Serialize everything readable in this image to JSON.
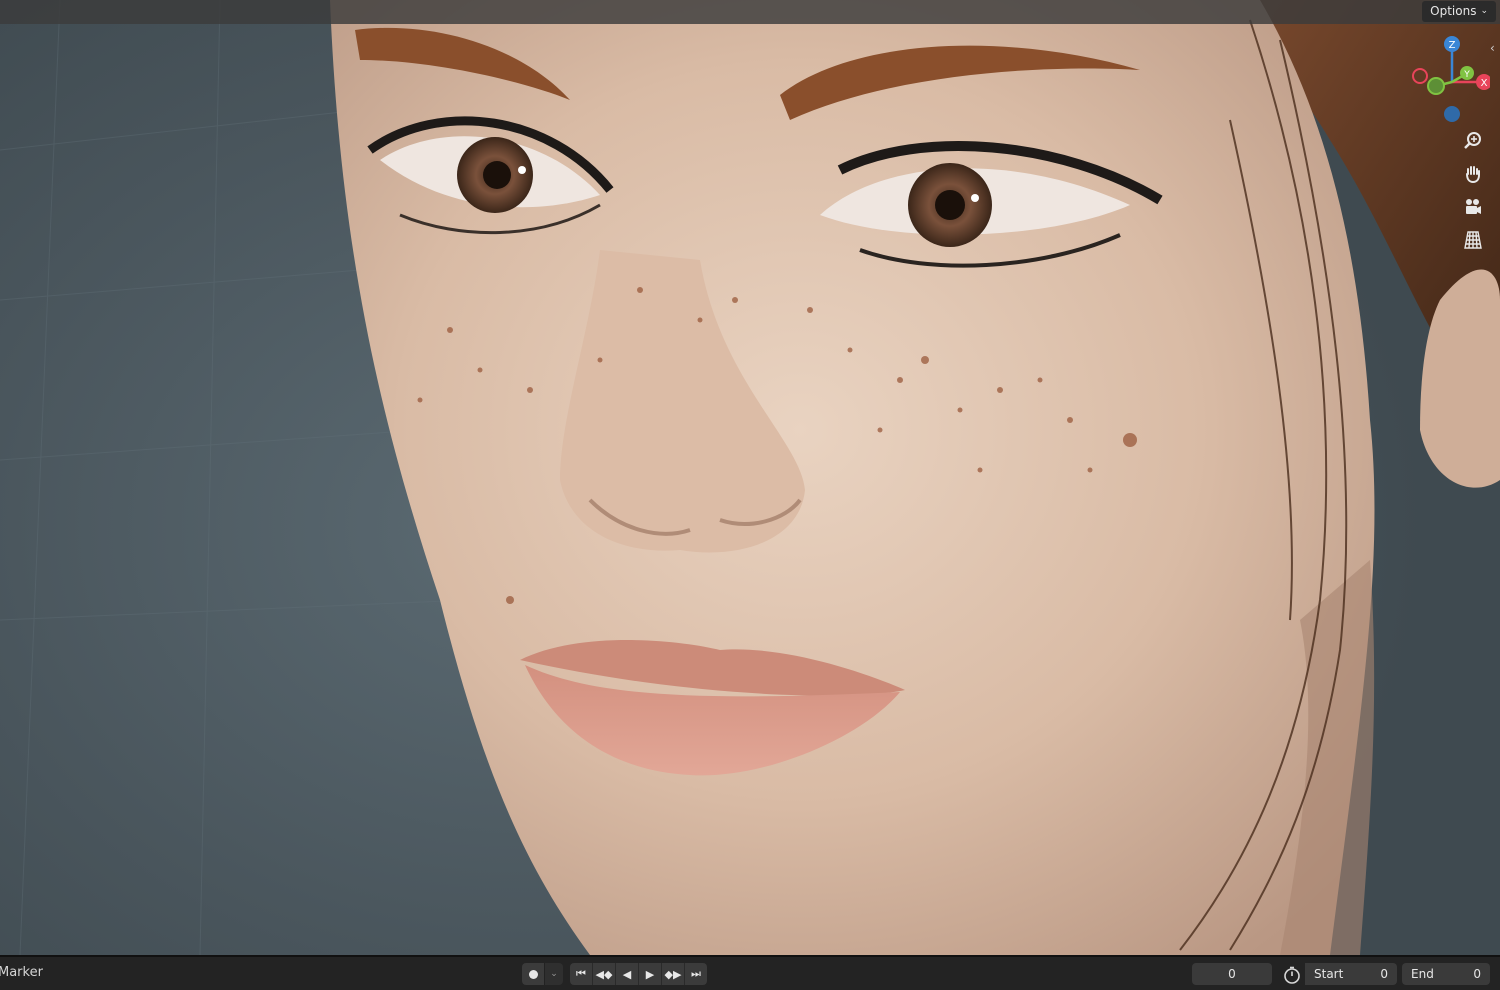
{
  "viewport": {
    "options_label": "Options",
    "gizmo": {
      "x_label": "X",
      "y_label": "Y",
      "z_label": "Z"
    },
    "nav_tools": [
      {
        "name": "zoom-icon"
      },
      {
        "name": "hand-pan-icon"
      },
      {
        "name": "camera-view-icon"
      },
      {
        "name": "ortho-grid-icon"
      }
    ],
    "colors": {
      "x_axis": "#e8445a",
      "y_axis": "#80c342",
      "z_axis": "#3a86d6"
    }
  },
  "timeline": {
    "marker_label": "Marker",
    "current_frame": "0",
    "start_label": "Start",
    "start_value": "0",
    "end_label": "End",
    "end_value": "0"
  }
}
